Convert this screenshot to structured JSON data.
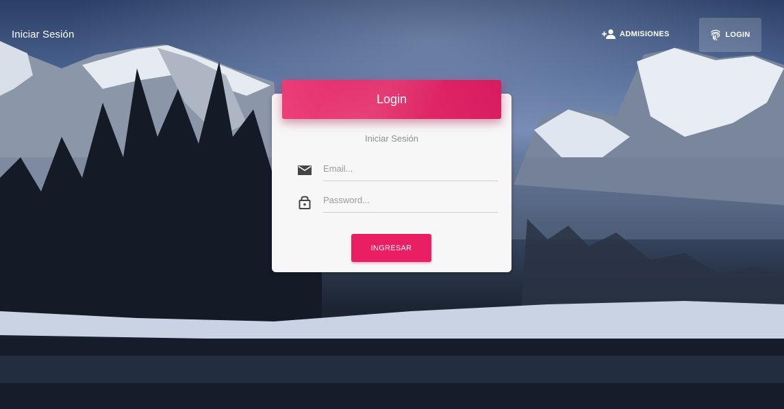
{
  "navbar": {
    "brand": "Iniciar Sesión",
    "items": [
      {
        "label": "Admisiones",
        "icon": "person-add-icon"
      },
      {
        "label": "Login",
        "icon": "fingerprint-icon",
        "active": true
      }
    ]
  },
  "card": {
    "title": "Login",
    "subtitle": "Iniciar Sesión",
    "email": {
      "placeholder": "Email...",
      "value": "",
      "icon": "mail-icon"
    },
    "password": {
      "placeholder": "Password...",
      "value": "",
      "icon": "lock-icon"
    },
    "submit_label": "Ingresar"
  },
  "colors": {
    "accent": "#e91e63",
    "header_gradient_start": "#ec407a",
    "header_gradient_end": "#d81b60",
    "card_bg": "#f7f7f7"
  }
}
